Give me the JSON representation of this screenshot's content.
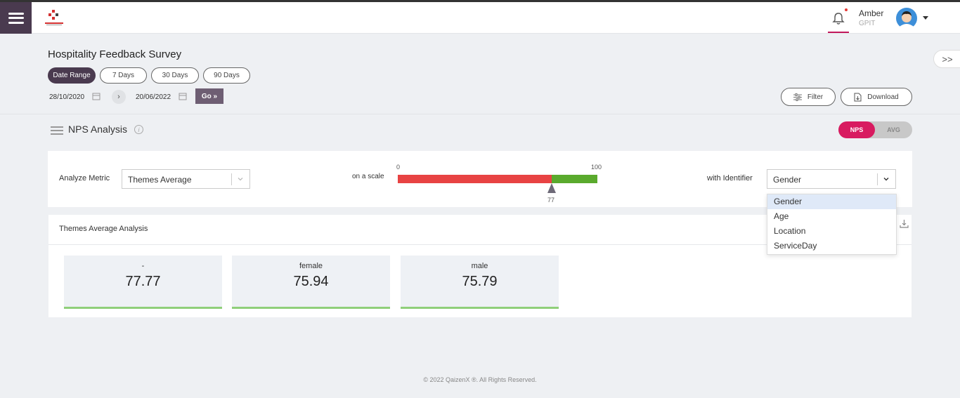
{
  "header": {
    "user_name": "Amber",
    "user_org": "GPIT",
    "brand_color": "#c2185b",
    "menu_bg": "#4a3a4f"
  },
  "survey": {
    "title": "Hospitality Feedback Survey",
    "range_buttons": [
      "Date Range",
      "7 Days",
      "30 Days",
      "90 Days"
    ],
    "active_range": "Date Range",
    "start_date": "28/10/2020",
    "end_date": "20/06/2022",
    "go_label": "Go »",
    "filter_label": "Filter",
    "download_label": "Download",
    "side_toggle": ">>"
  },
  "nps": {
    "title": "NPS Analysis",
    "info": "i",
    "toggle_on": "NPS",
    "toggle_off": "AVG"
  },
  "metric": {
    "analyze_label": "Analyze Metric",
    "metric_value": "Themes Average",
    "scale_label": "on a scale",
    "scale_min": "0",
    "scale_max": "100",
    "scale_marker": "77",
    "scale_marker_value": 77,
    "identifier_label": "with Identifier",
    "identifier_value": "Gender",
    "identifier_options": [
      "Gender",
      "Age",
      "Location",
      "ServiceDay"
    ],
    "bar_colors": {
      "low": "#e84343",
      "high": "#5aaa2d"
    }
  },
  "analysis": {
    "title": "Themes Average Analysis",
    "tiles": [
      {
        "label": "-",
        "value": "77.77"
      },
      {
        "label": "female",
        "value": "75.94"
      },
      {
        "label": "male",
        "value": "75.79"
      }
    ]
  },
  "footer": {
    "text": "© 2022 QaizenX ®. All Rights Reserved."
  }
}
